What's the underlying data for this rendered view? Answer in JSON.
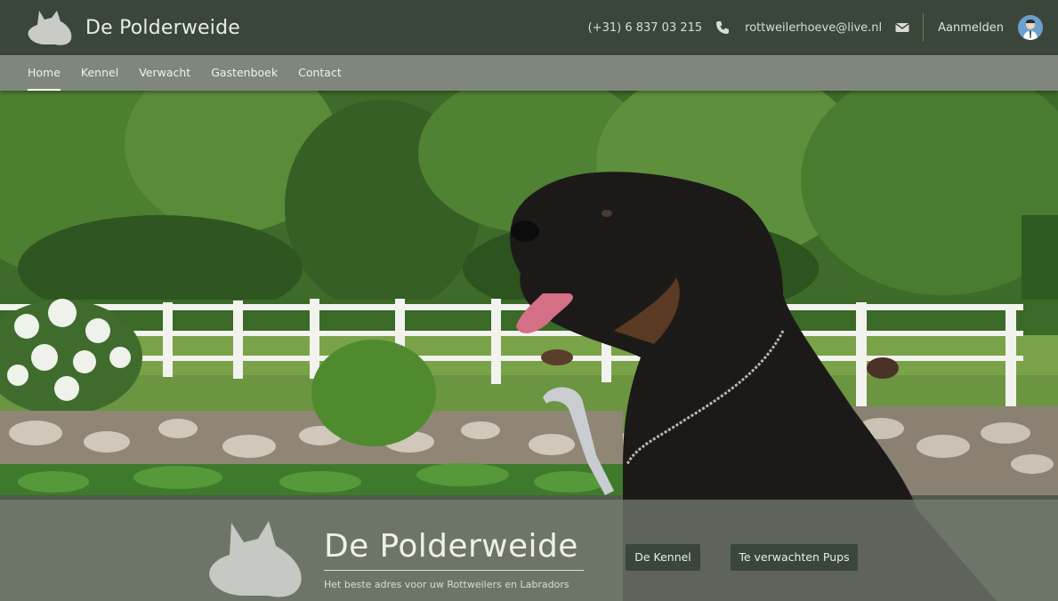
{
  "header": {
    "site_title": "De Polderweide",
    "phone": "(+31) 6 837 03 215",
    "email": "rottweilerhoeve@live.nl",
    "login_label": "Aanmelden"
  },
  "nav": {
    "items": [
      {
        "label": "Home"
      },
      {
        "label": "Kennel"
      },
      {
        "label": "Verwacht"
      },
      {
        "label": "Gastenboek"
      },
      {
        "label": "Contact"
      }
    ]
  },
  "hero": {
    "title": "De Polderweide",
    "subtitle": "Het beste adres voor uw Rottweilers en Labradors",
    "buttons": {
      "kennel": "De Kennel",
      "pups": "Te verwachten Pups"
    }
  },
  "colors": {
    "header_bg": "#3b463a",
    "nav_bg": "#7f877d",
    "button_bg": "#3b463a"
  },
  "icons": {
    "logo": "dog-head-logo",
    "phone": "phone-icon",
    "mail": "envelope-icon",
    "avatar": "user-avatar"
  }
}
